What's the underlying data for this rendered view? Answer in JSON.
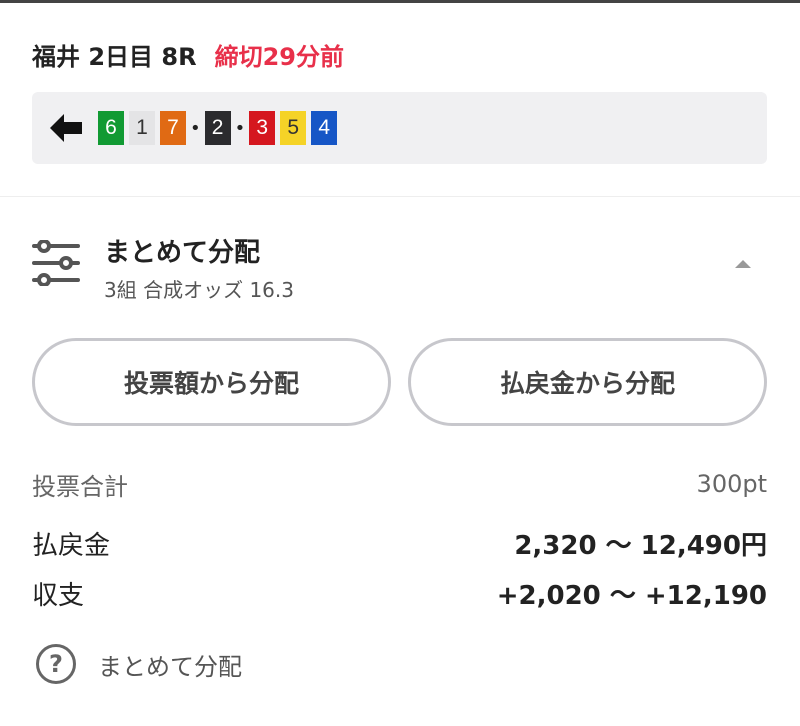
{
  "race": {
    "name": "福井 2日目 8R",
    "deadline": "締切29分前"
  },
  "combination": {
    "direction_icon": "arrow-left-icon",
    "numbers": [
      {
        "label": "6",
        "bg": "#119a33",
        "fg": "#ffffff"
      },
      {
        "label": "1",
        "bg": "#e4e4e6",
        "fg": "#333333"
      },
      {
        "label": "7",
        "bg": "#e06a14",
        "fg": "#ffffff"
      },
      {
        "label": "2",
        "bg": "#2b2b2e",
        "fg": "#ffffff"
      },
      {
        "label": "3",
        "bg": "#d5171f",
        "fg": "#ffffff"
      },
      {
        "label": "5",
        "bg": "#f5d327",
        "fg": "#333333"
      },
      {
        "label": "4",
        "bg": "#1656c6",
        "fg": "#ffffff"
      }
    ],
    "separator": "•"
  },
  "distribution": {
    "icon": "sliders-icon",
    "title": "まとめて分配",
    "subtitle": "3組 合成オッズ 16.3",
    "collapse_icon": "caret-up-icon"
  },
  "buttons": {
    "by_bet": "投票額から分配",
    "by_payout": "払戻金から分配"
  },
  "summary": {
    "total_label": "投票合計",
    "total_value": "300pt",
    "payout_label": "払戻金",
    "payout_value": "2,320 〜 12,490円",
    "profit_label": "収支",
    "profit_value": "+2,020 〜 +12,190"
  },
  "help": {
    "icon": "question-icon",
    "label": "まとめて分配",
    "symbol": "?"
  },
  "colors": {
    "deadline": "#e8304a",
    "combo_bg": "#f0f0f2",
    "button_border": "#c7c7cc"
  }
}
